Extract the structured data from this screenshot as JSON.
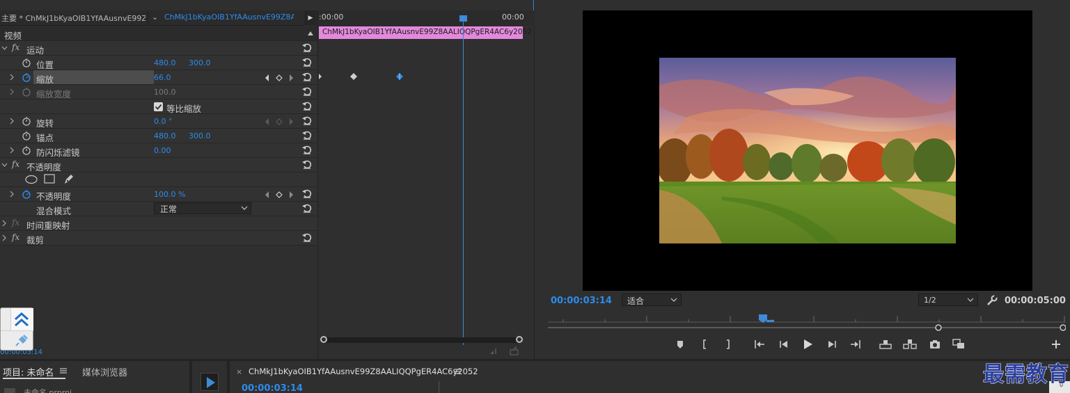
{
  "effect_controls": {
    "header": {
      "master_tab": "主要 * ChMkJ1bKyaOIB1YfAAusnvE99Z...",
      "clip_tab": "ChMkJ1bKyaOIB1YfAAusnvE99Z8AA..."
    },
    "section_video": "视频",
    "motion": {
      "label": "运动",
      "position": {
        "label": "位置",
        "x": "480.0",
        "y": "300.0"
      },
      "scale": {
        "label": "缩放",
        "value": "66.0"
      },
      "scale_width": {
        "label": "缩放宽度",
        "value": "100.0"
      },
      "uniform_scale": {
        "label": "等比缩放",
        "checked": true
      },
      "rotation": {
        "label": "旋转",
        "value": "0.0 °"
      },
      "anchor": {
        "label": "锚点",
        "x": "480.0",
        "y": "300.0"
      },
      "anti_flicker": {
        "label": "防闪烁滤镜",
        "value": "0.00"
      }
    },
    "opacity": {
      "label": "不透明度",
      "opacity_prop": {
        "label": "不透明度",
        "value": "100.0 %"
      },
      "blend_mode": {
        "label": "混合模式",
        "value": "正常"
      }
    },
    "time_remap": {
      "label": "时间重映射"
    },
    "crop": {
      "label": "裁剪"
    },
    "timeline": {
      "time_start": ":00:00",
      "time_end": "00:00",
      "clip_name": "ChMkJ1bKyaOIB1YfAAusnvE99Z8AALIQQPgER4AC6y2052"
    },
    "footer_time": "00:00:03:14"
  },
  "program_monitor": {
    "timecode_current": "00:00:03:14",
    "fit_label": "适合",
    "resolution_label": "1/2",
    "timecode_duration": "00:00:05:00"
  },
  "project_panel": {
    "tab_label": "项目: 未命名",
    "media_browser_label": "媒体浏览器",
    "item_name": "未命名.prproj"
  },
  "sequence_panel": {
    "tab_label": "ChMkJ1bKyaOIB1YfAAusnvE99Z8AALIQQPgER4AC6y2052",
    "timecode": "00:00:03:14"
  },
  "brand": {
    "label": "最需教育",
    "meter_value": "0"
  },
  "colors": {
    "accent_blue": "#2d8ceb",
    "clip_pink": "#e389dc",
    "panel_bg": "#2f2f2f"
  }
}
